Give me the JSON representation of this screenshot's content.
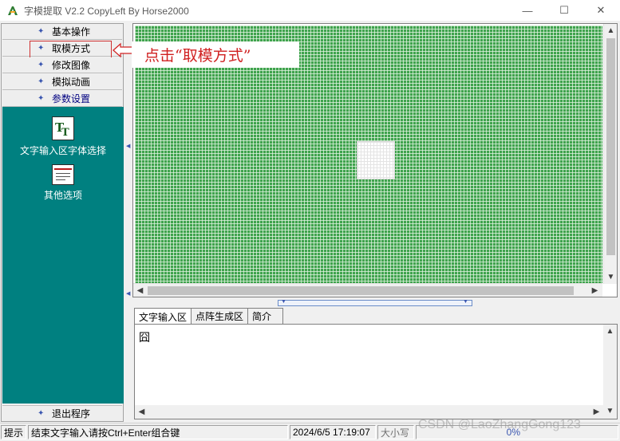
{
  "window": {
    "title": "字模提取 V2.2  CopyLeft By Horse2000",
    "minimize": "—",
    "maximize": "☐",
    "close": "✕"
  },
  "sidebar": {
    "items": [
      {
        "label": "基本操作"
      },
      {
        "label": "取模方式"
      },
      {
        "label": "修改图像"
      },
      {
        "label": "模拟动画"
      },
      {
        "label": "参数设置"
      }
    ],
    "tools": [
      {
        "label": "文字输入区字体选择",
        "icon": "font-icon"
      },
      {
        "label": "其他选项",
        "icon": "options-icon"
      }
    ],
    "exit_label": "退出程序"
  },
  "annotation": {
    "text": "点击“取模方式”"
  },
  "bottom_tabs": [
    {
      "label": "文字输入区"
    },
    {
      "label": "点阵生成区"
    },
    {
      "label": "简介"
    }
  ],
  "input_area": {
    "value": "囧"
  },
  "statusbar": {
    "hint_label": "提示",
    "hint_text": "结束文字输入请按Ctrl+Enter组合键",
    "datetime": "2024/6/5 17:19:07",
    "size_label": "大小写",
    "percent": "0%"
  },
  "watermark": "CSDN @LaoZhangGong123",
  "colors": {
    "grid_green": "#3fa34d",
    "panel_teal": "#008080",
    "annotation_red": "#d02020"
  }
}
